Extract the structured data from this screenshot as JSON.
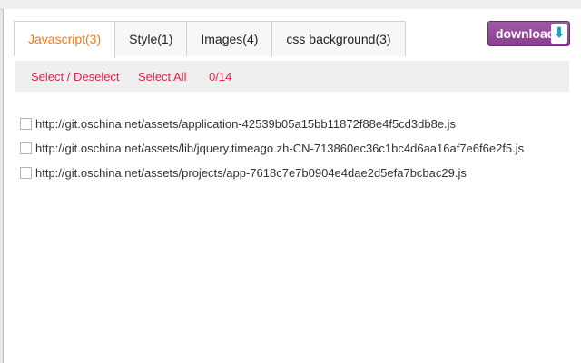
{
  "tabs": [
    {
      "label": "Javascript(3)",
      "active": true
    },
    {
      "label": "Style(1)",
      "active": false
    },
    {
      "label": "Images(4)",
      "active": false
    },
    {
      "label": "css background(3)",
      "active": false
    }
  ],
  "download": {
    "label": "download",
    "icon": "arrow-down-icon"
  },
  "toolbar": {
    "select_deselect": "Select / Deselect",
    "select_all": "Select All",
    "count": "0/14"
  },
  "files": [
    {
      "url": "http://git.oschina.net/assets/application-42539b05a15bb11872f88e4f5cd3db8e.js",
      "checked": false
    },
    {
      "url": "http://git.oschina.net/assets/lib/jquery.timeago.zh-CN-713860ec36c1bc4d6aa16af7e6f6e2f5.js",
      "checked": false
    },
    {
      "url": "http://git.oschina.net/assets/projects/app-7618c7e7b0904e4dae2d5efa7bcbac29.js",
      "checked": false
    }
  ]
}
